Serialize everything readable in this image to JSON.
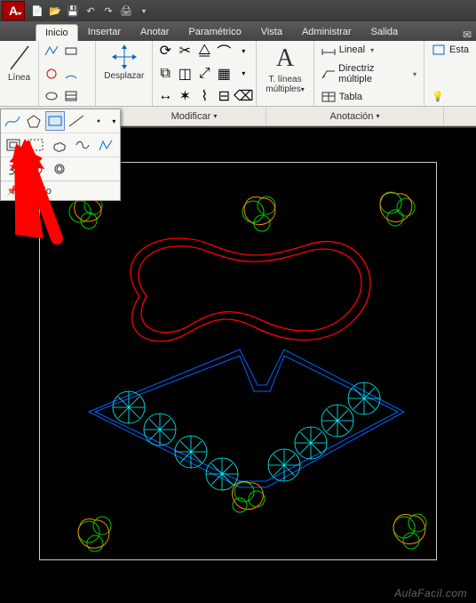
{
  "app": {
    "logo_letter": "A"
  },
  "qat": {
    "new": "new-icon",
    "open": "open-icon",
    "save": "save-icon",
    "undo": "undo-icon",
    "redo": "redo-icon",
    "print": "print-icon"
  },
  "menu": {
    "tabs": [
      "Inicio",
      "Insertar",
      "Anotar",
      "Paramétrico",
      "Vista",
      "Administrar",
      "Salida"
    ],
    "active_index": 0
  },
  "ribbon": {
    "linea_panel": {
      "big_label": "Línea"
    },
    "desplazar_panel": {
      "big_label": "Desplazar"
    },
    "annotation_panel": {
      "big_letter": "A",
      "big_label_line1": "T. líneas",
      "big_label_line2": "múltiples",
      "lineal_label": "Lineal",
      "directriz_label": "Directriz múltiple",
      "tabla_label": "Tabla"
    },
    "right_cut": {
      "label": "Esta"
    }
  },
  "panel_labels": {
    "modificar": "Modificar",
    "anotacion": "Anotación"
  },
  "flyout": {
    "footer_label": "Dibujo"
  },
  "watermark": "AulaFacil.com"
}
